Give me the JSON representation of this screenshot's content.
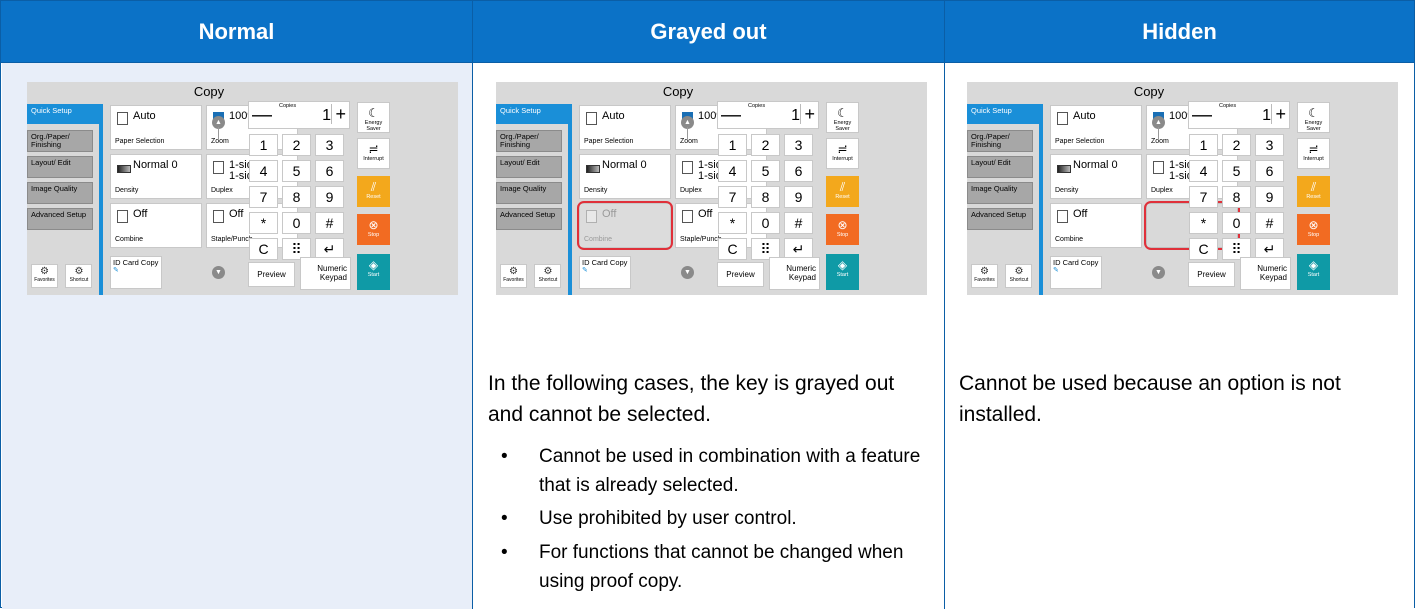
{
  "columns": [
    {
      "header": "Normal"
    },
    {
      "header": "Grayed out"
    },
    {
      "header": "Hidden"
    }
  ],
  "screen": {
    "title": "Copy",
    "tabs": [
      "Quick Setup",
      "Org./Paper/ Finishing",
      "Layout/ Edit",
      "Image Quality",
      "Advanced Setup"
    ],
    "tiles": {
      "paper": {
        "value": "Auto",
        "label": "Paper Selection"
      },
      "zoom": {
        "value": "100%",
        "label": "Zoom"
      },
      "density": {
        "value": "Normal 0",
        "label": "Density"
      },
      "duplex": {
        "value": "1-sided>> 1-sided",
        "label": "Duplex"
      },
      "combine": {
        "value": "Off",
        "label": "Combine"
      },
      "staple": {
        "value": "Off",
        "label": "Staple/Punch"
      }
    },
    "id_card": "ID Card Copy",
    "favorites": "Favorites",
    "shortcut": "Shortcut",
    "copies_caption": "Copies",
    "copies_value": "1",
    "minus": "—",
    "plus": "+",
    "keys": [
      "1",
      "2",
      "3",
      "4",
      "5",
      "6",
      "7",
      "8",
      "9",
      "*",
      "0",
      "#",
      "C",
      "⠿",
      "↵"
    ],
    "preview": "Preview",
    "numeric_keypad": "Numeric Keypad",
    "side_buttons": [
      {
        "label": "Energy Saver",
        "glyph": "☾"
      },
      {
        "label": "Interrupt",
        "glyph": "≓"
      },
      {
        "label": "Reset",
        "glyph": "⫽"
      },
      {
        "label": "Stop",
        "glyph": "⊗"
      },
      {
        "label": "Start",
        "glyph": "◈"
      }
    ],
    "colors": {
      "accent": "#1a8fd8",
      "reset": "#f3a81c",
      "stop": "#f26b22",
      "start": "#0f9aa6",
      "highlight": "#e0303a"
    }
  },
  "grayed_out": {
    "intro": "In the following cases, the key is grayed out and cannot be selected.",
    "bullets": [
      "Cannot be used in combination with a feature that is already selected.",
      "Use prohibited by user control.",
      "For functions that cannot be changed when using proof copy."
    ]
  },
  "hidden": {
    "text": "Cannot be used because an option is not installed."
  },
  "colors": {
    "header_bg": "#0b72c7",
    "normal_bg": "#e8eef9",
    "border": "#0b5ea6"
  }
}
